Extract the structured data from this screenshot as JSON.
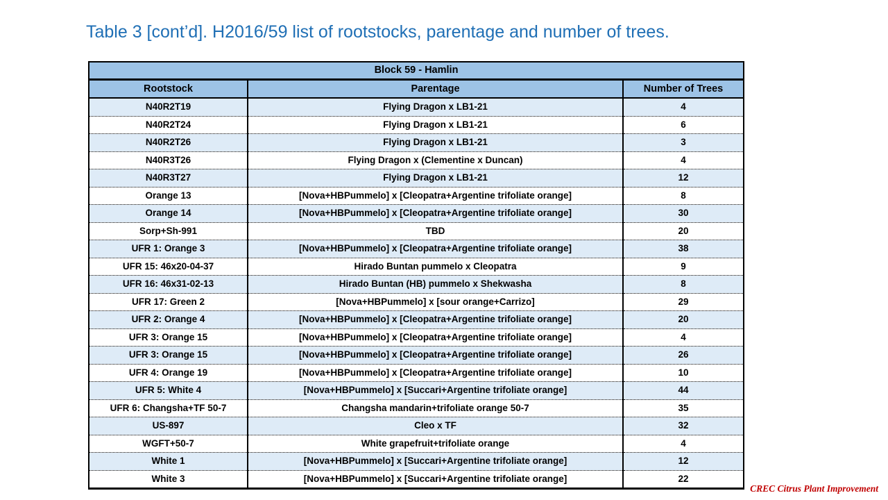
{
  "slide": {
    "title": "Table 3 [cont’d].  H2016/59 list of rootstocks, parentage and number of trees.",
    "title_color": "#1F6FB5",
    "footer": "CREC Citrus Plant Improvement",
    "footer_color": "#C00000"
  },
  "table": {
    "block_title": "Block 59 - Hamlin",
    "header_fill": "#9DC3E6",
    "stripe_fill": "#DEEBF7",
    "columns": [
      "Rootstock",
      "Parentage",
      "Number of Trees"
    ],
    "rows": [
      {
        "rootstock": "N40R2T19",
        "parentage": "Flying Dragon x LB1-21",
        "trees": "4"
      },
      {
        "rootstock": "N40R2T24",
        "parentage": "Flying Dragon x LB1-21",
        "trees": "6"
      },
      {
        "rootstock": "N40R2T26",
        "parentage": "Flying Dragon x LB1-21",
        "trees": "3"
      },
      {
        "rootstock": "N40R3T26",
        "parentage": "Flying Dragon x (Clementine x Duncan)",
        "trees": "4"
      },
      {
        "rootstock": "N40R3T27",
        "parentage": "Flying Dragon x LB1-21",
        "trees": "12"
      },
      {
        "rootstock": "Orange 13",
        "parentage": "[Nova+HBPummelo] x [Cleopatra+Argentine trifoliate orange]",
        "trees": "8"
      },
      {
        "rootstock": "Orange 14",
        "parentage": "[Nova+HBPummelo] x [Cleopatra+Argentine trifoliate orange]",
        "trees": "30"
      },
      {
        "rootstock": "Sorp+Sh-991",
        "parentage": "TBD",
        "trees": "20"
      },
      {
        "rootstock": "UFR 1: Orange 3",
        "parentage": "[Nova+HBPummelo] x [Cleopatra+Argentine trifoliate orange]",
        "trees": "38"
      },
      {
        "rootstock": "UFR 15: 46x20-04-37",
        "parentage": "Hirado Buntan pummelo x Cleopatra",
        "trees": "9"
      },
      {
        "rootstock": "UFR 16: 46x31-02-13",
        "parentage": "Hirado Buntan (HB) pummelo x Shekwasha",
        "trees": "8"
      },
      {
        "rootstock": "UFR 17: Green 2",
        "parentage": "[Nova+HBPummelo] x [sour orange+Carrizo]",
        "trees": "29"
      },
      {
        "rootstock": "UFR 2: Orange 4",
        "parentage": "[Nova+HBPummelo] x [Cleopatra+Argentine trifoliate orange]",
        "trees": "20"
      },
      {
        "rootstock": "UFR 3: Orange 15",
        "parentage": "[Nova+HBPummelo] x [Cleopatra+Argentine trifoliate orange]",
        "trees": "4"
      },
      {
        "rootstock": "UFR 3: Orange 15",
        "parentage": "[Nova+HBPummelo] x [Cleopatra+Argentine trifoliate orange]",
        "trees": "26"
      },
      {
        "rootstock": "UFR 4: Orange 19",
        "parentage": "[Nova+HBPummelo] x [Cleopatra+Argentine trifoliate orange]",
        "trees": "10"
      },
      {
        "rootstock": "UFR 5: White 4",
        "parentage": "[Nova+HBPummelo] x [Succari+Argentine trifoliate orange]",
        "trees": "44"
      },
      {
        "rootstock": "UFR 6: Changsha+TF 50-7",
        "parentage": "Changsha mandarin+trifoliate orange 50-7",
        "trees": "35"
      },
      {
        "rootstock": "US-897",
        "parentage": "Cleo x TF",
        "trees": "32"
      },
      {
        "rootstock": "WGFT+50-7",
        "parentage": "White grapefruit+trifoliate orange",
        "trees": "4"
      },
      {
        "rootstock": "White 1",
        "parentage": "[Nova+HBPummelo] x [Succari+Argentine trifoliate orange]",
        "trees": "12"
      },
      {
        "rootstock": "White 3",
        "parentage": "[Nova+HBPummelo] x [Succari+Argentine trifoliate orange]",
        "trees": "22"
      }
    ]
  }
}
